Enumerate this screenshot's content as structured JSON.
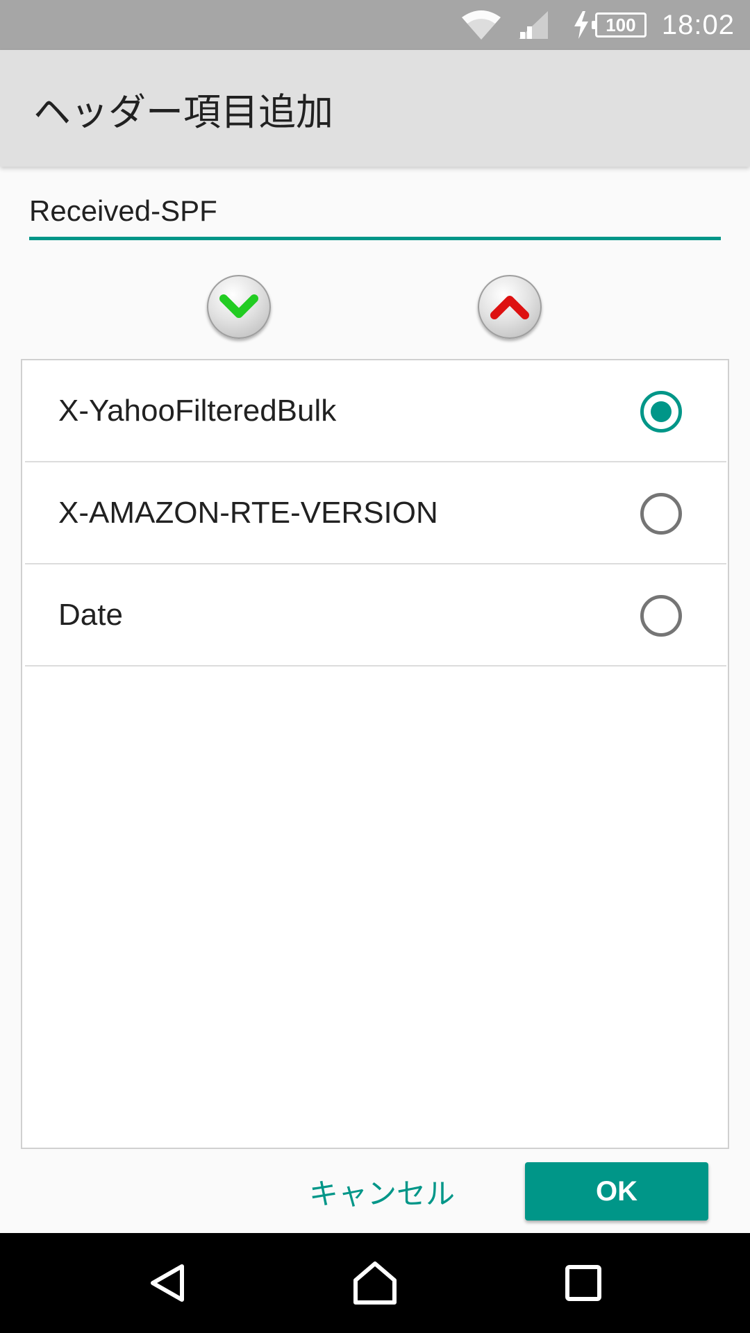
{
  "status_bar": {
    "battery_level": "100",
    "time": "18:02",
    "icons": [
      "wifi-icon",
      "cell-signal-icon",
      "charging-icon",
      "battery-icon"
    ]
  },
  "dialog": {
    "title": "ヘッダー項目追加",
    "input_value": "Received-SPF",
    "move_down_icon": "chevron-down-icon",
    "move_up_icon": "chevron-up-icon",
    "items": [
      {
        "label": "X-YahooFilteredBulk",
        "selected": true
      },
      {
        "label": "X-AMAZON-RTE-VERSION",
        "selected": false
      },
      {
        "label": "Date",
        "selected": false
      }
    ],
    "cancel_label": "キャンセル",
    "ok_label": "OK"
  },
  "nav_bar": {
    "icons": [
      "back-icon",
      "home-icon",
      "recent-apps-icon"
    ]
  },
  "colors": {
    "accent": "#009688",
    "status_bar": "#a6a6a6",
    "title_bar": "#e0e0e0",
    "move_down_arrow": "#22cc22",
    "move_up_arrow": "#dd1111"
  }
}
